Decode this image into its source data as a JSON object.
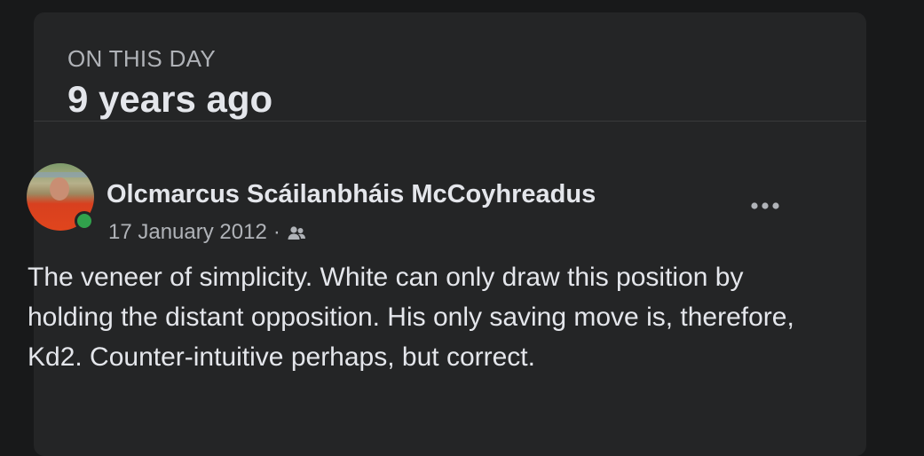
{
  "memories": {
    "kicker": "ON THIS DAY",
    "headline": "9 years ago"
  },
  "post": {
    "author": "Olcmarcus Scáilanbháis McCoyhreadus",
    "date": "17 January 2012",
    "separator": "·",
    "audience_icon": "friends-icon",
    "more_icon": "more-horizontal-icon",
    "avatar_status": "online",
    "text": "The veneer of simplicity. White can only draw this position by holding the distant opposition. His only saving move is, therefore, Kd2. Counter-intuitive perhaps, but correct."
  },
  "colors": {
    "page_background": "#18191a",
    "card_background": "#242526",
    "primary_text": "#e4e6eb",
    "secondary_text": "#b0b3b8",
    "divider": "#3a3b3c",
    "online_green": "#31a24c"
  }
}
